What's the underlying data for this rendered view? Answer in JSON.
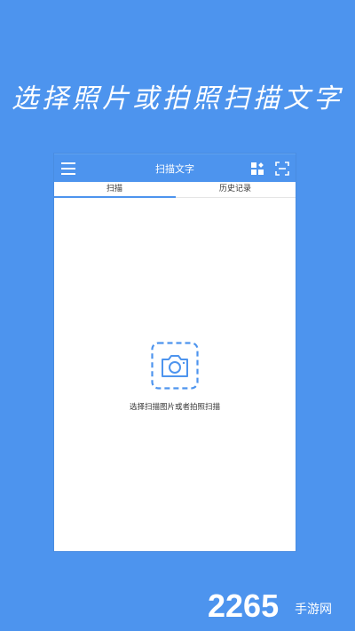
{
  "banner": {
    "headline": "选择照片或拍照扫描文字"
  },
  "app": {
    "title": "扫描文字",
    "tabs": [
      {
        "label": "扫描",
        "active": true
      },
      {
        "label": "历史记录",
        "active": false
      }
    ],
    "hint": "选择扫描图片或者拍照扫描"
  },
  "watermark": {
    "brand": "2265",
    "subtitle": "手游网"
  },
  "colors": {
    "background": "#4d94ee",
    "accent": "#4d94ee",
    "panel": "#ffffff"
  },
  "icons": {
    "menu": "hamburger-icon",
    "grid": "grid-icon",
    "scan": "scan-frame-icon",
    "camera": "camera-icon"
  }
}
